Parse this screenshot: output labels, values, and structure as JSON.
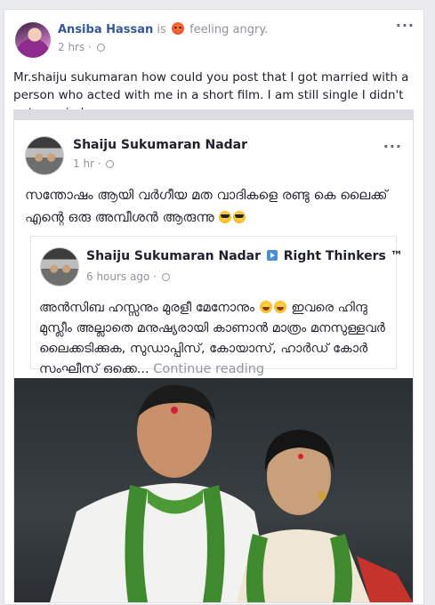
{
  "post": {
    "author": "Ansiba Hassan",
    "is_text": "is",
    "feeling": "feeling angry.",
    "time": "2 hrs ·",
    "more": "···",
    "text": "Mr.shaiju sukumaran how could you post that I got married with a person who acted with me in a short film. I am still single I didn't get married ."
  },
  "shared_post": {
    "author": "Shaiju Sukumaran Nadar",
    "time": "1 hr ·",
    "more": "···",
    "text": "സന്തോഷം ആയി വർഗീയ മത വാദികളെ രണ്ടു കെ ലൈക്ക് എന്റെ ഒരു അമ്പീശൻ ആരുന്നു"
  },
  "inner_post": {
    "author": "Shaiju Sukumaran Nadar",
    "page": "Right Thinkers ™",
    "time": "6 hours ago ·",
    "text_line1": "അൻസിബ ഹസ്സനും മുരളീ മേനോനും",
    "text_line1b": "ഇവരെ ഹിന്ദു",
    "text_rest": "മുസ്ലീം അല്ലാതെ മനുഷ്യരായി കാണാൻ മാത്രം മനസുള്ളവർ ലൈക്കടിക്കുക, സുഡാപ്പിസ്, കോയാസ്, ഹാർഡ് കോർ സംഘീസ് ഒക്കെ...",
    "continue": "Continue reading"
  },
  "icons": {
    "avatar": "profile-photo",
    "angry": "angry-emoji",
    "globe": "globe-icon",
    "emoji_shades": "sunglasses-emoji",
    "emoji_laugh": "laughing-emoji",
    "page_flag": "page-arrow-icon"
  }
}
